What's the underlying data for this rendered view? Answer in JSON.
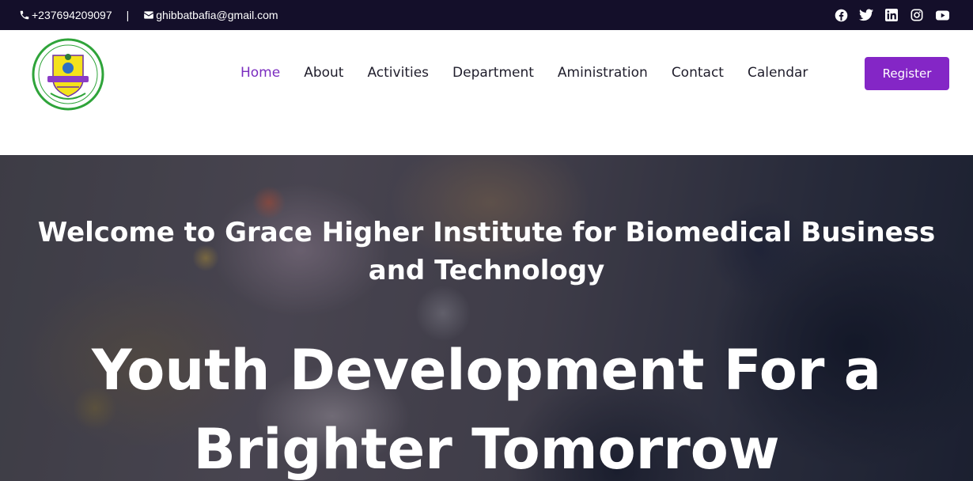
{
  "topbar": {
    "phone": "+237694209097",
    "separator": "|",
    "email": "ghibbatbafia@gmail.com",
    "social_icons": [
      "facebook-icon",
      "twitter-icon",
      "linkedin-icon",
      "instagram-icon",
      "youtube-icon"
    ]
  },
  "nav": {
    "items": [
      {
        "label": "Home",
        "active": true
      },
      {
        "label": "About"
      },
      {
        "label": "Activities"
      },
      {
        "label": "Department"
      },
      {
        "label": "Aministration"
      },
      {
        "label": "Contact"
      },
      {
        "label": "Calendar"
      }
    ],
    "register_label": "Register"
  },
  "hero": {
    "title": "Welcome to Grace Higher Institute for Biomedical Business and Technology",
    "heading": "Youth Development For a Brighter Tomorrow"
  },
  "colors": {
    "topbar_bg": "#140f2a",
    "accent": "#8426c6",
    "nav_active": "#7a2cbf"
  }
}
